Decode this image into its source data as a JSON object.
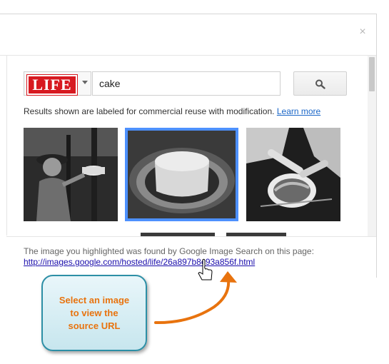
{
  "dialog": {
    "close_symbol": "×",
    "close_icon": "close-icon"
  },
  "search": {
    "source_logo_text": "LIFE",
    "query": "cake",
    "search_icon": "magnifier-icon"
  },
  "results": {
    "note": "Results shown are labeled for commercial reuse with modification.",
    "learn_more": "Learn more",
    "selected_index": 1
  },
  "footer": {
    "found_text": "The image you highlighted was found by Google Image Search on this page:",
    "source_url": "http://images.google.com/hosted/life/26a897b8c93a856f.html"
  },
  "callout": {
    "text_line1": "Select an image",
    "text_line2": "to view the",
    "text_line3": "source URL",
    "text_color": "#e8730e",
    "border_color": "#2d8fa6",
    "arrow_color": "#e8730e"
  },
  "accent": {
    "selection_color": "#4d90fe",
    "link_color": "#1a66c7"
  }
}
